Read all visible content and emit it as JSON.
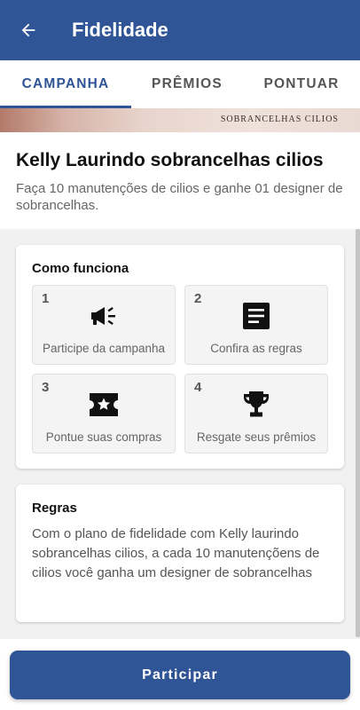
{
  "appbar": {
    "title": "Fidelidade",
    "back_icon": "arrow-back-icon"
  },
  "tabs": [
    {
      "label": "CAMPANHA",
      "active": true
    },
    {
      "label": "PRÊMIOS",
      "active": false
    },
    {
      "label": "PONTUAR",
      "active": false
    }
  ],
  "banner": {
    "text": "SOBRANCELHAS CILIOS"
  },
  "campaign": {
    "title": "Kelly Laurindo sobrancelhas cilios",
    "description": "Faça 10 manutenções de cilios e ganhe 01 designer de sobrancelhas."
  },
  "how_it_works": {
    "title": "Como funciona",
    "steps": [
      {
        "number": "1",
        "label": "Participe da campanha",
        "icon": "megaphone-icon"
      },
      {
        "number": "2",
        "label": "Confira as regras",
        "icon": "document-icon"
      },
      {
        "number": "3",
        "label": "Pontue suas compras",
        "icon": "ticket-star-icon"
      },
      {
        "number": "4",
        "label": "Resgate seus prêmios",
        "icon": "trophy-icon"
      }
    ]
  },
  "rules": {
    "title": "Regras",
    "text": "Com o plano de fidelidade com Kelly laurindo sobrancelhas cilios, a cada 10 manutençõens de cilios você ganha um designer de sobrancelhas"
  },
  "footer": {
    "button_label": "Participar"
  },
  "colors": {
    "primary": "#2f5597",
    "background": "#f1f1f1"
  }
}
